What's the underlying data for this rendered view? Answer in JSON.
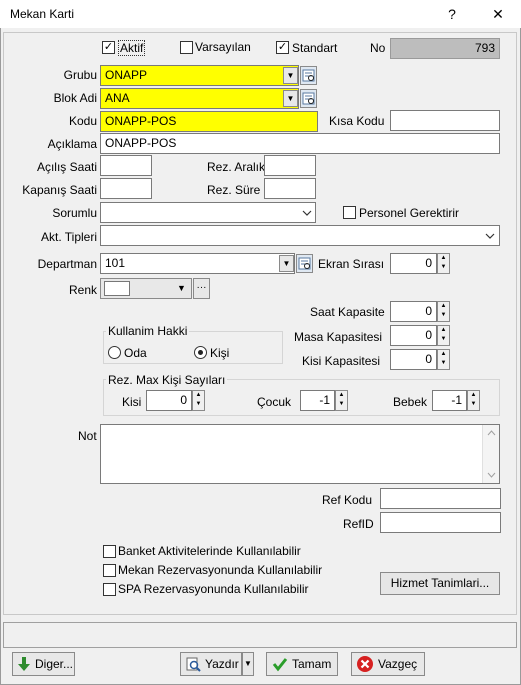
{
  "window": {
    "title": "Mekan Karti",
    "help": "?",
    "close": "✕"
  },
  "flags": {
    "aktif": {
      "label": "Aktif",
      "checked": true
    },
    "varsayilan": {
      "label": "Varsayılan",
      "checked": false
    },
    "standart": {
      "label": "Standart",
      "checked": true
    }
  },
  "no": {
    "label": "No",
    "value": "793"
  },
  "grubu": {
    "label": "Grubu",
    "value": "ONAPP"
  },
  "blok_adi": {
    "label": "Blok Adi",
    "value": "ANA"
  },
  "kodu": {
    "label": "Kodu",
    "value": "ONAPP-POS"
  },
  "kisa_kodu": {
    "label": "Kısa Kodu",
    "value": ""
  },
  "aciklama": {
    "label": "Açıklama",
    "value": "ONAPP-POS"
  },
  "acilis_saati": {
    "label": "Açılış Saati",
    "value": ""
  },
  "rez_aralik": {
    "label": "Rez. Aralık",
    "value": ""
  },
  "kapanis_saati": {
    "label": "Kapanış Saati",
    "value": ""
  },
  "rez_sure": {
    "label": "Rez. Süre",
    "value": ""
  },
  "sorumlu": {
    "label": "Sorumlu",
    "value": ""
  },
  "personel_gerektirir": {
    "label": "Personel Gerektirir",
    "checked": false
  },
  "akt_tipleri": {
    "label": "Akt. Tipleri",
    "value": ""
  },
  "departman": {
    "label": "Departman",
    "value": "101"
  },
  "ekran_sirasi": {
    "label": "Ekran Sırası",
    "value": "0"
  },
  "renk": {
    "label": "Renk",
    "more": "···"
  },
  "saat_kapasite": {
    "label": "Saat Kapasite",
    "value": "0"
  },
  "masa_kapasitesi": {
    "label": "Masa Kapasitesi",
    "value": "0"
  },
  "kisi_kapasitesi": {
    "label": "Kisi Kapasitesi",
    "value": "0"
  },
  "kullanim_hakki": {
    "title": "Kullanim Hakki",
    "oda": "Oda",
    "kisi": "Kişi",
    "selected": "kisi"
  },
  "rez_max": {
    "title": "Rez. Max Kişi Sayıları",
    "kisi": {
      "label": "Kisi",
      "value": "0"
    },
    "cocuk": {
      "label": "Çocuk",
      "value": "-1"
    },
    "bebek": {
      "label": "Bebek",
      "value": "-1"
    }
  },
  "not": {
    "label": "Not",
    "value": ""
  },
  "ref_kodu": {
    "label": "Ref Kodu",
    "value": ""
  },
  "ref_id": {
    "label": "RefID",
    "value": ""
  },
  "options": {
    "banket": {
      "label": "Banket Aktivitelerinde Kullanılabilir",
      "checked": false
    },
    "mekan_rez": {
      "label": "Mekan Rezervasyonunda Kullanılabilir",
      "checked": false
    },
    "spa_rez": {
      "label": "SPA Rezervasyonunda Kullanılabilir",
      "checked": false
    }
  },
  "hizmet_button": "Hizmet Tanimlari...",
  "footer": {
    "diger": "Diger...",
    "yazdir": "Yazdır",
    "tamam": "Tamam",
    "vazgec": "Vazgeç"
  },
  "colors": {
    "highlight": "#ffff00",
    "readonly": "#bdbdbd",
    "ok": "#2a9d2a",
    "cancel": "#d62020",
    "down": "#2e8b2e"
  }
}
